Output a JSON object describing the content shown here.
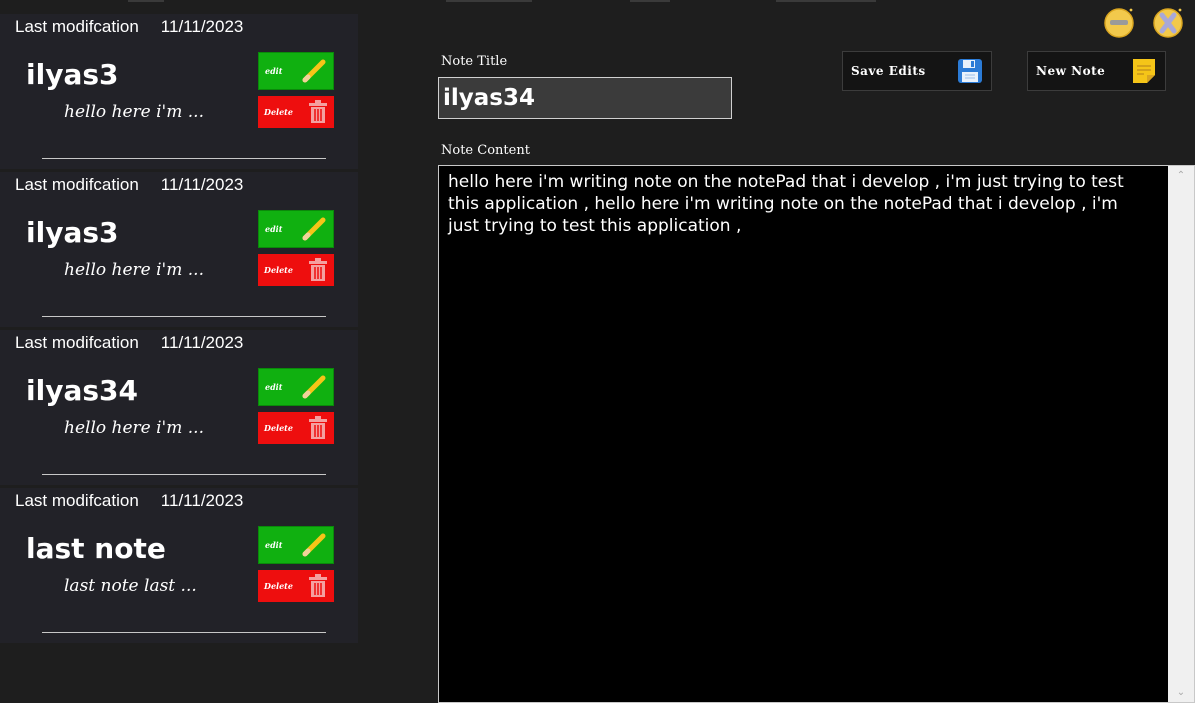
{
  "notes": [
    {
      "date_label": "Last modifcation",
      "date": "11/11/2023",
      "title": "ilyas3",
      "preview": "hello here i'm ...",
      "edit_label": "edit",
      "delete_label": "Delete"
    },
    {
      "date_label": "Last modifcation",
      "date": "11/11/2023",
      "title": "ilyas3",
      "preview": "hello here i'm ...",
      "edit_label": "edit",
      "delete_label": "Delete"
    },
    {
      "date_label": "Last modifcation",
      "date": "11/11/2023",
      "title": "ilyas34",
      "preview": "hello here i'm ...",
      "edit_label": "edit",
      "delete_label": "Delete"
    },
    {
      "date_label": "Last modifcation",
      "date": "11/11/2023",
      "title": "last note",
      "preview": "last note last ...",
      "edit_label": "edit",
      "delete_label": "Delete"
    }
  ],
  "editor": {
    "title_label": "Note Title",
    "title_value": "ilyas34",
    "content_label": "Note Content",
    "content_value": "hello here i'm writing note on the notePad that i develop , i'm just trying to test this application , hello here i'm writing note on the notePad that i develop , i'm just trying to test this application ,"
  },
  "toolbar": {
    "save_label": "Save Edits",
    "new_label": "New Note"
  },
  "icons": {
    "edit": "pencil-icon",
    "delete": "trash-icon",
    "save": "floppy-disk-icon",
    "new": "sticky-note-icon",
    "minimize": "minimize-icon",
    "close": "close-icon"
  },
  "colors": {
    "background": "#1e1e1e",
    "sidebar_card": "#222228",
    "edit_button": "#10b010",
    "delete_button": "#ee0e0e",
    "content_background": "#000000",
    "title_input_background": "#3b3b3b",
    "window_button": "#f2c94c"
  }
}
